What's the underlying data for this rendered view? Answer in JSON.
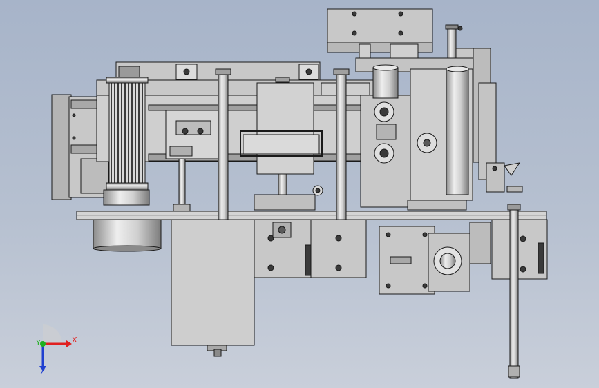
{
  "viewport": {
    "background_top": "#a7b4c9",
    "background_bottom": "#c9cfda"
  },
  "palette": {
    "part_fill": "#c8c8c8",
    "part_light": "#dcdcdc",
    "part_dark": "#9a9a9a",
    "edge": "#1a1a1a",
    "accent_dark": "#3a3a3a"
  },
  "triad": {
    "x_label": "X",
    "y_label": "Y",
    "z_label": "Z",
    "x_color": "#e02020",
    "y_color": "#20b020",
    "z_color": "#2040d0"
  }
}
